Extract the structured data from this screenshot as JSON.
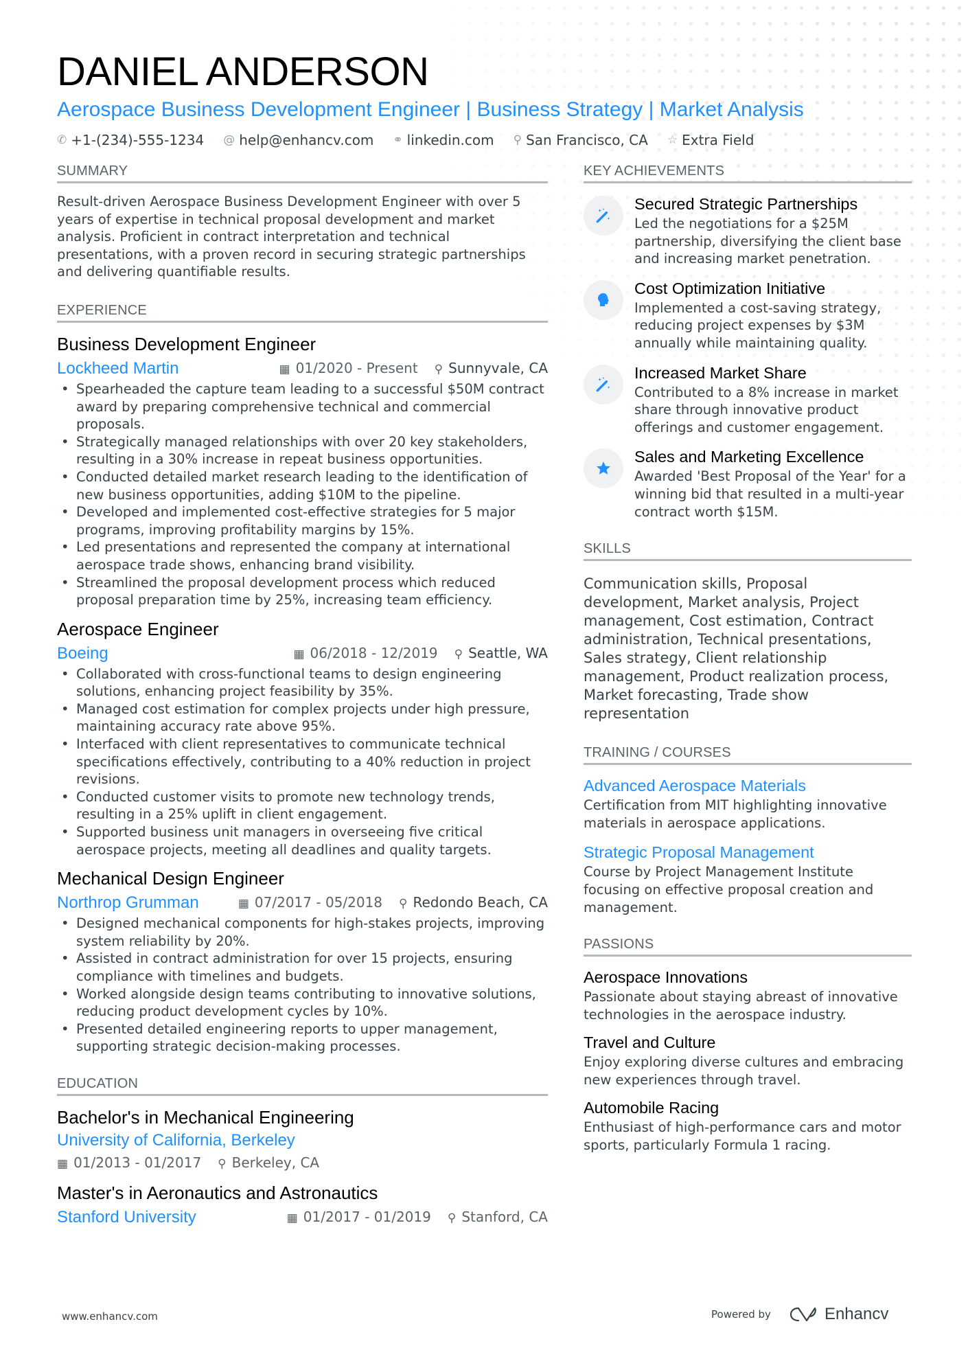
{
  "header": {
    "name": "DANIEL ANDERSON",
    "headline": "Aerospace Business Development Engineer | Business Strategy | Market Analysis",
    "contacts": [
      {
        "icon": "phone-icon",
        "glyph": "✆",
        "text": "+1-(234)-555-1234"
      },
      {
        "icon": "at-icon",
        "glyph": "@",
        "text": "help@enhancv.com"
      },
      {
        "icon": "link-icon",
        "glyph": "⚭",
        "text": "linkedin.com"
      },
      {
        "icon": "location-icon",
        "glyph": "⚲",
        "text": "San Francisco, CA"
      },
      {
        "icon": "star-outline-icon",
        "glyph": "☆",
        "text": "Extra Field"
      }
    ]
  },
  "summary": {
    "title": "Summary",
    "text": "Result-driven Aerospace Business Development Engineer with over 5 years of expertise in technical proposal development and market analysis. Proficient in contract interpretation and technical presentations, with a proven record in securing strategic partnerships and delivering quantifiable results."
  },
  "experience": {
    "title": "Experience",
    "jobs": [
      {
        "title": "Business Development Engineer",
        "company": "Lockheed Martin",
        "dates": "01/2020 - Present",
        "location": "Sunnyvale, CA",
        "bullets": [
          "Spearheaded the capture team leading to a successful $50M contract award by preparing comprehensive technical and commercial proposals.",
          "Strategically managed relationships with over 20 key stakeholders, resulting in a 30% increase in repeat business opportunities.",
          "Conducted detailed market research leading to the identification of new business opportunities, adding $10M to the pipeline.",
          "Developed and implemented cost-effective strategies for 5 major programs, improving profitability margins by 15%.",
          "Led presentations and represented the company at international aerospace trade shows, enhancing brand visibility.",
          "Streamlined the proposal development process which reduced proposal preparation time by 25%, increasing team efficiency."
        ]
      },
      {
        "title": "Aerospace Engineer",
        "company": "Boeing",
        "dates": "06/2018 - 12/2019",
        "location": "Seattle, WA",
        "bullets": [
          "Collaborated with cross-functional teams to design engineering solutions, enhancing project feasibility by 35%.",
          "Managed cost estimation for complex projects under high pressure, maintaining accuracy rate above 95%.",
          "Interfaced with client representatives to communicate technical specifications effectively, contributing to a 40% reduction in project revisions.",
          "Conducted customer visits to promote new technology trends, resulting in a 25% uplift in client engagement.",
          "Supported business unit managers in overseeing five critical aerospace projects, meeting all deadlines and quality targets."
        ]
      },
      {
        "title": "Mechanical Design Engineer",
        "company": "Northrop Grumman",
        "dates": "07/2017 - 05/2018",
        "location": "Redondo Beach, CA",
        "bullets": [
          "Designed mechanical components for high-stakes projects, improving system reliability by 20%.",
          "Assisted in contract administration for over 15 projects, ensuring compliance with timelines and budgets.",
          "Worked alongside design teams contributing to innovative solutions, reducing product development cycles by 10%.",
          "Presented detailed engineering reports to upper management, supporting strategic decision-making processes."
        ]
      }
    ]
  },
  "education": {
    "title": "Education",
    "items": [
      {
        "degree": "Bachelor's in Mechanical Engineering",
        "school": "University of California, Berkeley",
        "dates": "01/2013 - 01/2017",
        "location": "Berkeley, CA"
      },
      {
        "degree": "Master's in Aeronautics and Astronautics",
        "school": "Stanford University",
        "dates": "01/2017 - 01/2019",
        "location": "Stanford, CA"
      }
    ]
  },
  "achievements": {
    "title": "Key Achievements",
    "items": [
      {
        "icon": "magic-wand-icon",
        "glyph": "🪄",
        "title": "Secured Strategic Partnerships",
        "desc": "Led the negotiations for a $25M partnership, diversifying the client base and increasing market penetration."
      },
      {
        "icon": "head-brain-icon",
        "glyph": "●",
        "title": "Cost Optimization Initiative",
        "desc": "Implemented a cost-saving strategy, reducing project expenses by $3M annually while maintaining quality."
      },
      {
        "icon": "magic-wand-icon",
        "glyph": "🪄",
        "title": "Increased Market Share",
        "desc": "Contributed to a 8% increase in market share through innovative product offerings and customer engagement."
      },
      {
        "icon": "star-icon",
        "glyph": "★",
        "title": "Sales and Marketing Excellence",
        "desc": "Awarded 'Best Proposal of the Year' for a winning bid that resulted in a multi-year contract worth $15M."
      }
    ]
  },
  "skills": {
    "title": "Skills",
    "text": "Communication skills, Proposal development, Market analysis, Project management, Cost estimation, Contract administration, Technical presentations, Sales strategy, Client relationship management, Product realization process, Market forecasting, Trade show representation"
  },
  "training": {
    "title": "Training / Courses",
    "items": [
      {
        "title": "Advanced Aerospace Materials",
        "desc": "Certification from MIT highlighting innovative materials in aerospace applications."
      },
      {
        "title": "Strategic Proposal Management",
        "desc": "Course by Project Management Institute focusing on effective proposal creation and management."
      }
    ]
  },
  "passions": {
    "title": "Passions",
    "items": [
      {
        "title": "Aerospace Innovations",
        "desc": "Passionate about staying abreast of innovative technologies in the aerospace industry."
      },
      {
        "title": "Travel and Culture",
        "desc": "Enjoy exploring diverse cultures and embracing new experiences through travel."
      },
      {
        "title": "Automobile Racing",
        "desc": "Enthusiast of high-performance cars and motor sports, particularly Formula 1 racing."
      }
    ]
  },
  "footer": {
    "website": "www.enhancv.com",
    "powered_by": "Powered by",
    "brand": "Enhancv"
  },
  "colors": {
    "accent": "#1e90ff",
    "text": "#384347",
    "heading": "#000000",
    "rule": "#b5b9bd"
  }
}
